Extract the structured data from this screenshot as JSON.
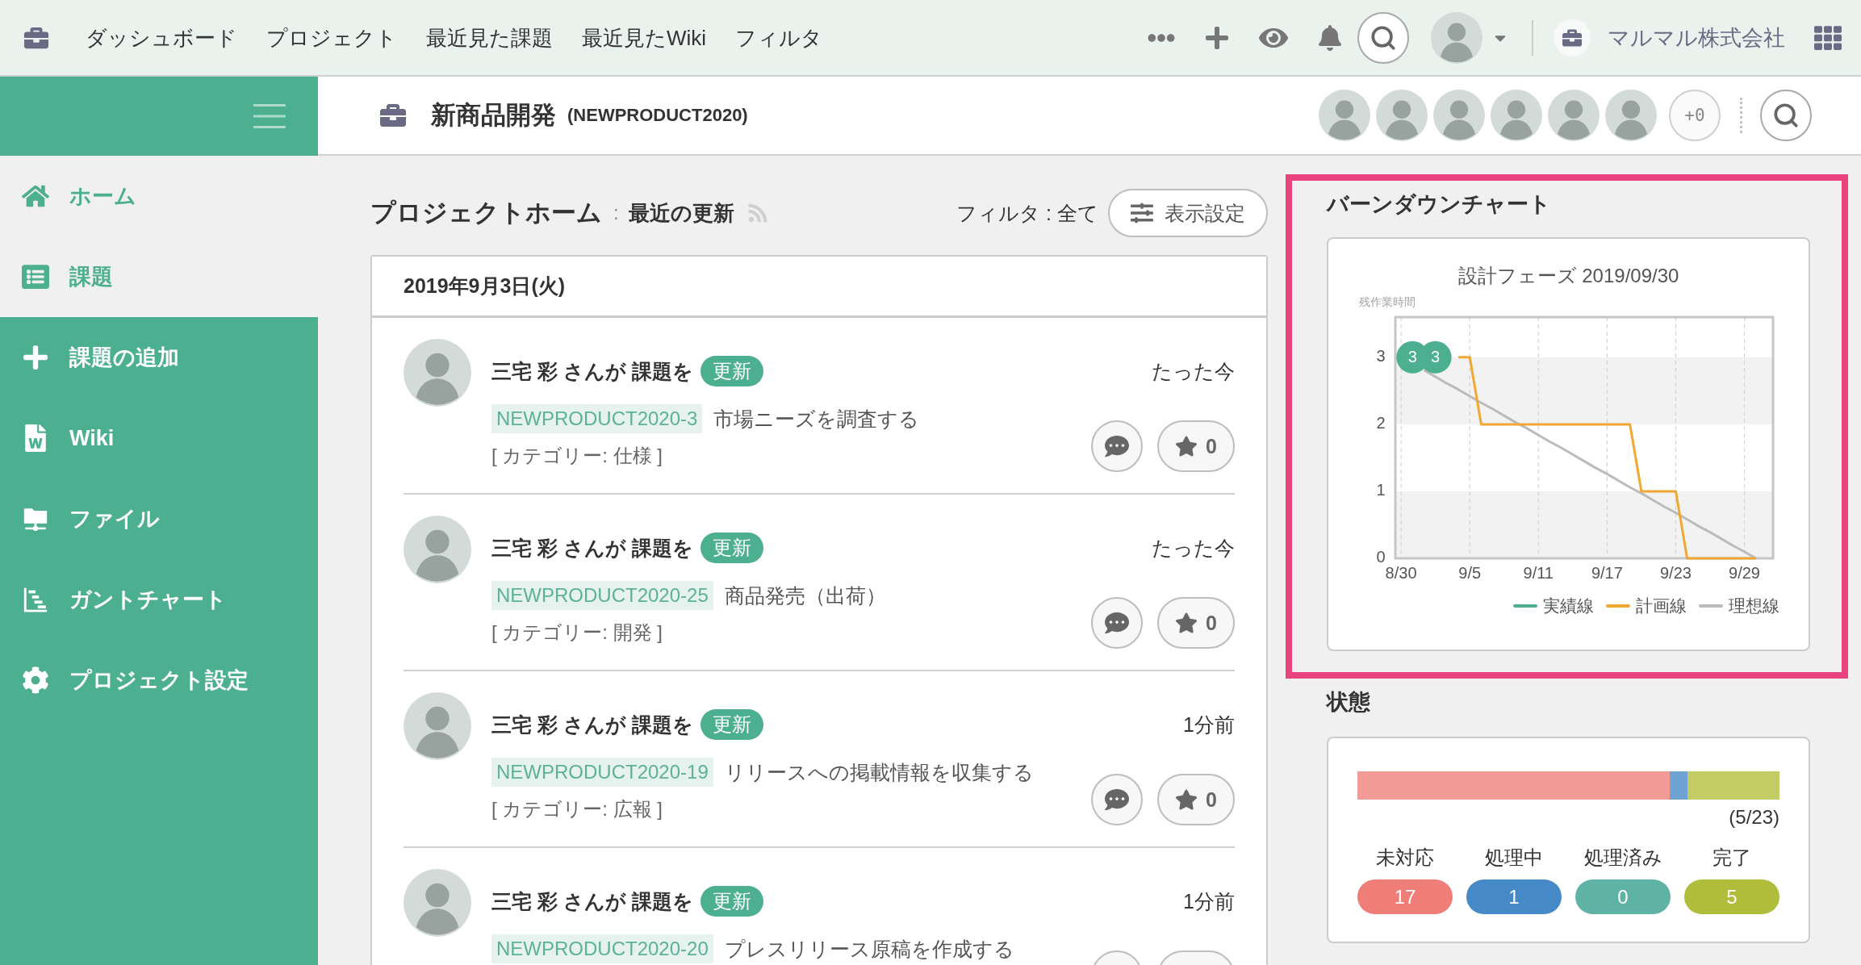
{
  "top_bar": {
    "nav_items": [
      "ダッシュボード",
      "プロジェクト",
      "最近見た課題",
      "最近見たWiki",
      "フィルタ"
    ],
    "company": "マルマル株式会社"
  },
  "project": {
    "name": "新商品開発",
    "key": "(NEWPRODUCT2020)",
    "more_members": "+0"
  },
  "sidebar": {
    "items": [
      {
        "kind": "home",
        "label": "ホーム",
        "highlighted": true
      },
      {
        "kind": "issues",
        "label": "課題",
        "highlighted": true
      },
      {
        "kind": "add",
        "label": "課題の追加",
        "highlighted": false
      },
      {
        "kind": "wiki",
        "label": "Wiki",
        "highlighted": false
      },
      {
        "kind": "files",
        "label": "ファイル",
        "highlighted": false
      },
      {
        "kind": "gantt",
        "label": "ガントチャート",
        "highlighted": false
      },
      {
        "kind": "settings",
        "label": "プロジェクト設定",
        "highlighted": false
      }
    ]
  },
  "feed": {
    "title": "プロジェクトホーム",
    "separator": ":",
    "subtitle": "最近の更新",
    "filter": "フィルタ : 全て",
    "settings_button": "表示設定",
    "date": "2019年9月3日(火)",
    "items": [
      {
        "actor": "三宅 彩 さんが 課題を",
        "action": "更新",
        "time": "たった今",
        "issue_key": "NEWPRODUCT2020-3",
        "summary": "市場ニーズを調査する",
        "category": "[ カテゴリー: 仕様 ]",
        "star_count": "0"
      },
      {
        "actor": "三宅 彩 さんが 課題を",
        "action": "更新",
        "time": "たった今",
        "issue_key": "NEWPRODUCT2020-25",
        "summary": "商品発売（出荷）",
        "category": "[ カテゴリー: 開発 ]",
        "star_count": "0"
      },
      {
        "actor": "三宅 彩 さんが 課題を",
        "action": "更新",
        "time": "1分前",
        "issue_key": "NEWPRODUCT2020-19",
        "summary": "リリースへの掲載情報を収集する",
        "category": "[ カテゴリー: 広報 ]",
        "star_count": "0"
      },
      {
        "actor": "三宅 彩 さんが 課題を",
        "action": "更新",
        "time": "1分前",
        "issue_key": "NEWPRODUCT2020-20",
        "summary": "プレスリリース原稿を作成する"
      }
    ]
  },
  "burndown": {
    "title": "バーンダウンチャート",
    "highlighted": true,
    "chart_data": {
      "type": "line",
      "title": "設計フェーズ 2019/09/30",
      "ylabel": "残作業時間",
      "categories": [
        "8/30",
        null,
        null,
        null,
        null,
        null,
        "9/5",
        null,
        null,
        null,
        null,
        null,
        "9/11",
        null,
        null,
        null,
        null,
        null,
        "9/17",
        null,
        null,
        null,
        null,
        null,
        "9/23",
        null,
        null,
        null,
        null,
        null,
        "9/29",
        null
      ],
      "series": [
        {
          "name": "実績線",
          "type": "scatter",
          "data_labels": true,
          "color": "#4caf8f",
          "values": [
            null,
            3,
            null,
            3,
            null,
            null,
            null,
            null,
            null,
            null,
            null,
            null,
            null,
            null,
            null,
            null,
            null,
            null,
            null,
            null,
            null,
            null,
            null,
            null,
            null,
            null,
            null,
            null,
            null,
            null,
            null,
            null
          ]
        },
        {
          "name": "計画線",
          "color": "#f0a830",
          "values": [
            null,
            null,
            null,
            null,
            null,
            3,
            3,
            2,
            2,
            2,
            2,
            2,
            2,
            2,
            2,
            2,
            2,
            2,
            2,
            2,
            2,
            1,
            1,
            1,
            1,
            0,
            0,
            0,
            0,
            0,
            0,
            0
          ]
        },
        {
          "name": "理想線",
          "color": "#bbbbbb",
          "values": [
            null,
            null,
            2.81,
            2.71,
            2.61,
            2.52,
            2.42,
            2.32,
            2.23,
            2.13,
            2.03,
            1.94,
            1.84,
            1.74,
            1.65,
            1.55,
            1.45,
            1.35,
            1.26,
            1.16,
            1.06,
            0.97,
            0.87,
            0.77,
            0.68,
            0.58,
            0.48,
            0.39,
            0.29,
            0.19,
            0.1,
            0
          ]
        }
      ],
      "ylim": [
        0,
        3.6
      ],
      "yticks": [
        0,
        1,
        2,
        3
      ],
      "grid": true,
      "legend": true
    }
  },
  "status": {
    "title": "状態",
    "ratio": "(5/23)",
    "items": [
      {
        "label": "未対応",
        "count": "17",
        "color": "#ee7e77"
      },
      {
        "label": "処理中",
        "count": "1",
        "color": "#4589c6"
      },
      {
        "label": "処理済み",
        "count": "0",
        "color": "#5eb3a5"
      },
      {
        "label": "完了",
        "count": "5",
        "color": "#b0bd3a"
      }
    ]
  }
}
